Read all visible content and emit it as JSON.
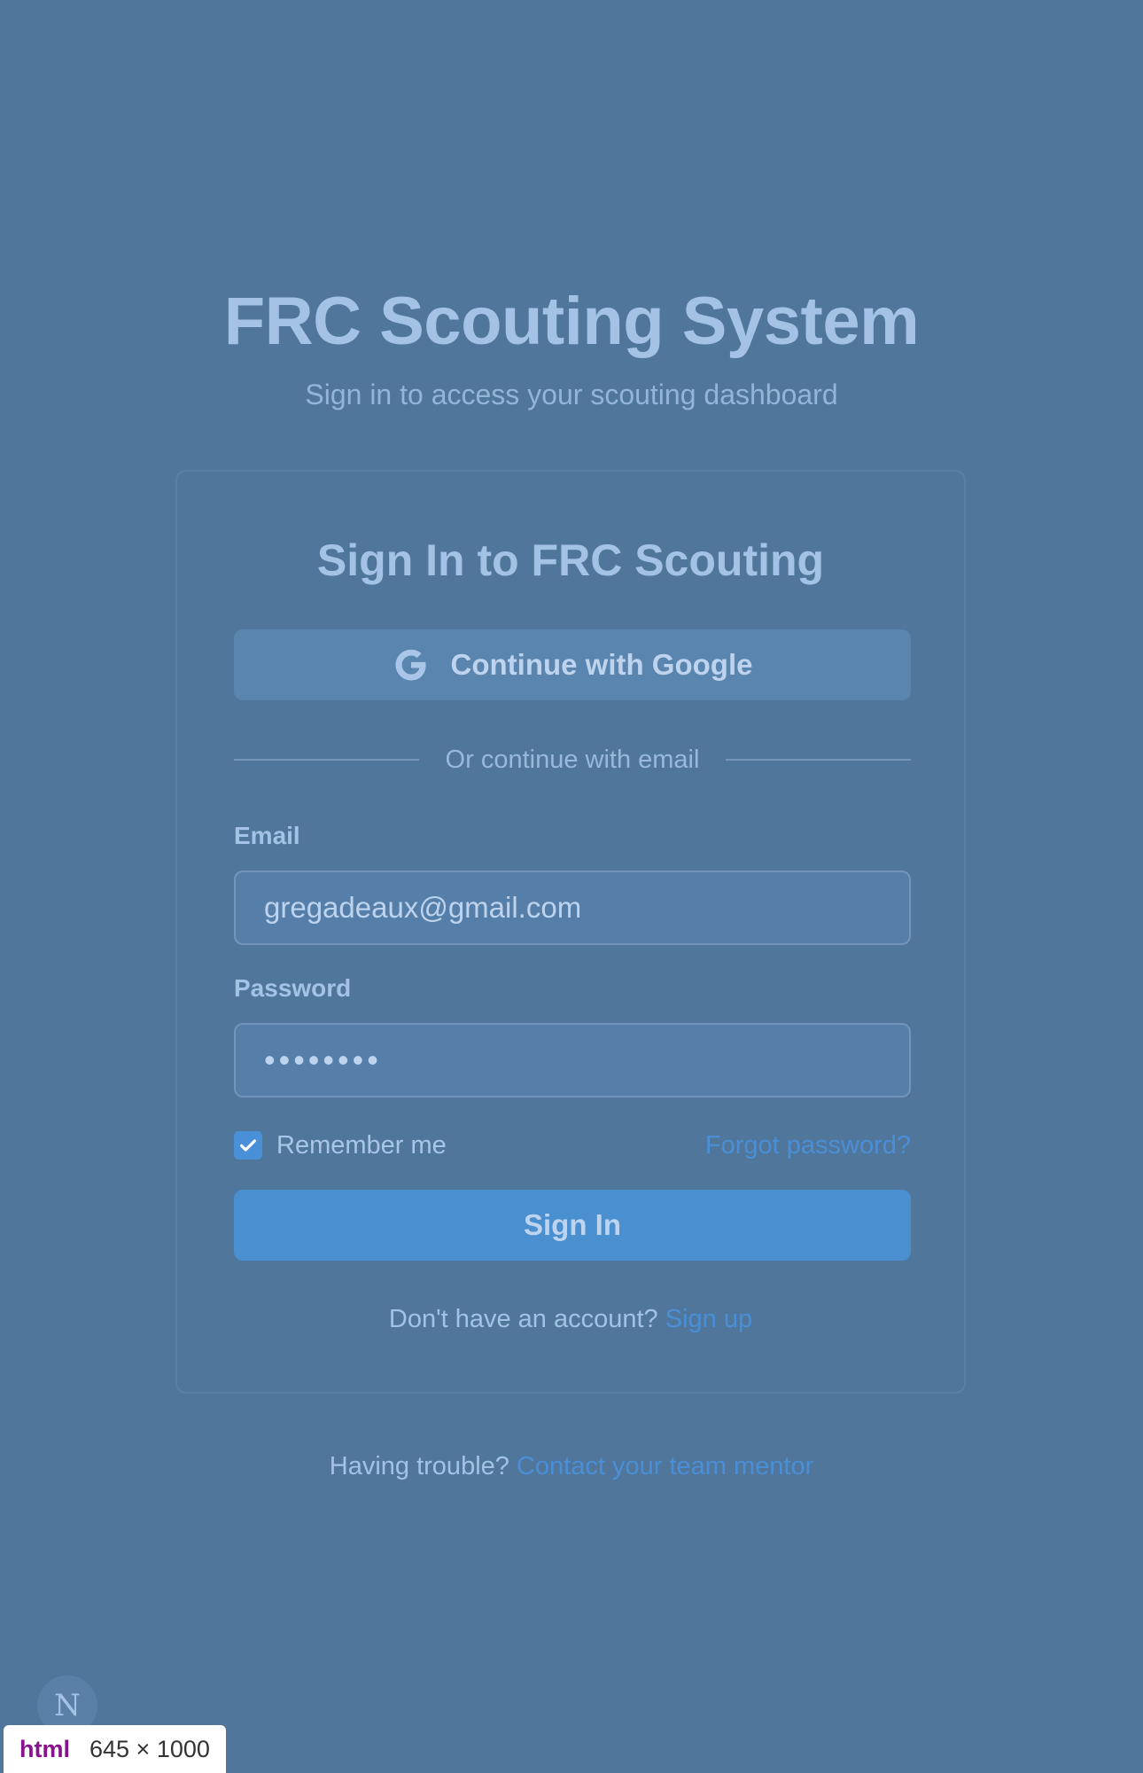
{
  "header": {
    "title": "FRC Scouting System",
    "subtitle": "Sign in to access your scouting dashboard"
  },
  "card": {
    "title": "Sign In to FRC Scouting",
    "google_button_label": "Continue with Google",
    "divider_text": "Or continue with email",
    "email_label": "Email",
    "email_value": "gregadeaux@gmail.com",
    "password_label": "Password",
    "password_masked": "••••••••",
    "remember_me_label": "Remember me",
    "remember_me_checked": true,
    "forgot_password_label": "Forgot password?",
    "signin_button_label": "Sign In",
    "no_account_text": "Don't have an account?",
    "signup_link": "Sign up"
  },
  "footer": {
    "trouble_text": "Having trouble?",
    "contact_link": "Contact your team mentor"
  },
  "devtools": {
    "next_badge": "N",
    "element_tag": "html",
    "element_size": "645 × 1000"
  },
  "colors": {
    "background": "#50769c",
    "accent": "#4a8fd6",
    "primary_button": "#4a8fd0"
  },
  "icons": {
    "google": "google-g-icon",
    "checkbox": "checkmark-icon"
  }
}
